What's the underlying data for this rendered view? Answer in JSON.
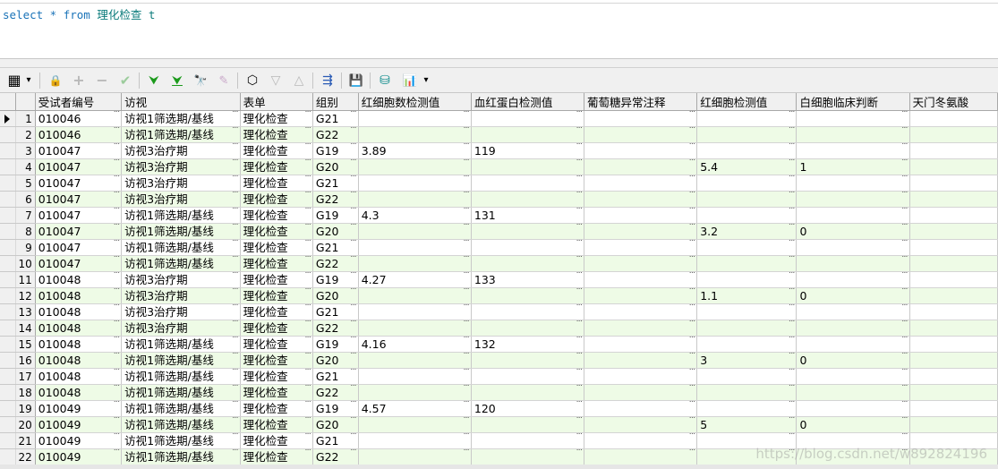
{
  "sql": {
    "kw_select": "select",
    "star": " * ",
    "kw_from": "from",
    "table": " 理化检查 t"
  },
  "toolbar": {
    "icons": {
      "grid": "▦",
      "dropdown": "▾",
      "lock": "🔒",
      "add": "+",
      "remove": "−",
      "post": "✔",
      "next": "⮟",
      "last": "⮟",
      "find": "🔭",
      "clear": "✎",
      "query_by_example": "⬡",
      "filter": "▽",
      "filter_clear": "△",
      "explain": "⇶",
      "save": "💾",
      "export": "⛁",
      "chart": "📊"
    }
  },
  "grid": {
    "columns": [
      "受试者编号",
      "访视",
      "表单",
      "组别",
      "红细胞数检测值",
      "血红蛋白检测值",
      "葡萄糖异常注释",
      "红细胞检测值",
      "白细胞临床判断",
      "天门冬氨酸"
    ],
    "rows": [
      {
        "n": "1",
        "c": [
          "010046",
          "访视1筛选期/基线",
          "理化检查",
          "G21",
          "",
          "",
          "",
          "",
          "",
          ""
        ]
      },
      {
        "n": "2",
        "c": [
          "010046",
          "访视1筛选期/基线",
          "理化检查",
          "G22",
          "",
          "",
          "",
          "",
          "",
          ""
        ]
      },
      {
        "n": "3",
        "c": [
          "010047",
          "访视3治疗期",
          "理化检查",
          "G19",
          "3.89",
          "119",
          "",
          "",
          "",
          ""
        ]
      },
      {
        "n": "4",
        "c": [
          "010047",
          "访视3治疗期",
          "理化检查",
          "G20",
          "",
          "",
          "",
          "5.4",
          "1",
          ""
        ]
      },
      {
        "n": "5",
        "c": [
          "010047",
          "访视3治疗期",
          "理化检查",
          "G21",
          "",
          "",
          "",
          "",
          "",
          ""
        ]
      },
      {
        "n": "6",
        "c": [
          "010047",
          "访视3治疗期",
          "理化检查",
          "G22",
          "",
          "",
          "",
          "",
          "",
          ""
        ]
      },
      {
        "n": "7",
        "c": [
          "010047",
          "访视1筛选期/基线",
          "理化检查",
          "G19",
          "4.3",
          "131",
          "",
          "",
          "",
          ""
        ]
      },
      {
        "n": "8",
        "c": [
          "010047",
          "访视1筛选期/基线",
          "理化检查",
          "G20",
          "",
          "",
          "",
          "3.2",
          "0",
          ""
        ]
      },
      {
        "n": "9",
        "c": [
          "010047",
          "访视1筛选期/基线",
          "理化检查",
          "G21",
          "",
          "",
          "",
          "",
          "",
          ""
        ]
      },
      {
        "n": "10",
        "c": [
          "010047",
          "访视1筛选期/基线",
          "理化检查",
          "G22",
          "",
          "",
          "",
          "",
          "",
          ""
        ]
      },
      {
        "n": "11",
        "c": [
          "010048",
          "访视3治疗期",
          "理化检查",
          "G19",
          "4.27",
          "133",
          "",
          "",
          "",
          ""
        ]
      },
      {
        "n": "12",
        "c": [
          "010048",
          "访视3治疗期",
          "理化检查",
          "G20",
          "",
          "",
          "",
          "1.1",
          "0",
          ""
        ]
      },
      {
        "n": "13",
        "c": [
          "010048",
          "访视3治疗期",
          "理化检查",
          "G21",
          "",
          "",
          "",
          "",
          "",
          ""
        ]
      },
      {
        "n": "14",
        "c": [
          "010048",
          "访视3治疗期",
          "理化检查",
          "G22",
          "",
          "",
          "",
          "",
          "",
          ""
        ]
      },
      {
        "n": "15",
        "c": [
          "010048",
          "访视1筛选期/基线",
          "理化检查",
          "G19",
          "4.16",
          "132",
          "",
          "",
          "",
          ""
        ]
      },
      {
        "n": "16",
        "c": [
          "010048",
          "访视1筛选期/基线",
          "理化检查",
          "G20",
          "",
          "",
          "",
          "3",
          "0",
          ""
        ]
      },
      {
        "n": "17",
        "c": [
          "010048",
          "访视1筛选期/基线",
          "理化检查",
          "G21",
          "",
          "",
          "",
          "",
          "",
          ""
        ]
      },
      {
        "n": "18",
        "c": [
          "010048",
          "访视1筛选期/基线",
          "理化检查",
          "G22",
          "",
          "",
          "",
          "",
          "",
          ""
        ]
      },
      {
        "n": "19",
        "c": [
          "010049",
          "访视1筛选期/基线",
          "理化检查",
          "G19",
          "4.57",
          "120",
          "",
          "",
          "",
          ""
        ]
      },
      {
        "n": "20",
        "c": [
          "010049",
          "访视1筛选期/基线",
          "理化检查",
          "G20",
          "",
          "",
          "",
          "5",
          "0",
          ""
        ]
      },
      {
        "n": "21",
        "c": [
          "010049",
          "访视1筛选期/基线",
          "理化检查",
          "G21",
          "",
          "",
          "",
          "",
          "",
          ""
        ]
      },
      {
        "n": "22",
        "c": [
          "010049",
          "访视1筛选期/基线",
          "理化检查",
          "G22",
          "",
          "",
          "",
          "",
          "",
          ""
        ]
      }
    ],
    "ellipsis": "···"
  },
  "watermark": "https://blog.csdn.net/w892824196"
}
